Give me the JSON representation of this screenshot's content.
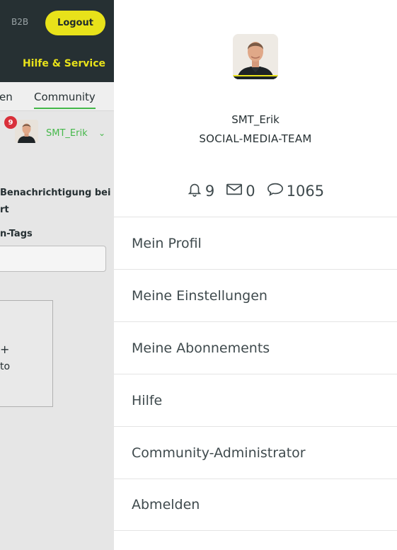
{
  "header": {
    "b2b_label": "B2B",
    "logout_label": "Logout",
    "hilfe_label": "Hilfe & Service"
  },
  "nav": {
    "prev_tab_partial": "en",
    "community_tab": "Community"
  },
  "user_bar": {
    "notification_count": "9",
    "username": "SMT_Erik"
  },
  "background_content": {
    "notification_text": "Benachrichtigung bei",
    "notification_text2": "rt",
    "tags_label": "n-Tags",
    "plus": "+",
    "upload_partial": "to"
  },
  "profile": {
    "username": "SMT_Erik",
    "role": "SOCIAL-MEDIA-TEAM",
    "stats": {
      "notifications": "9",
      "messages": "0",
      "comments": "1065"
    }
  },
  "menu": {
    "items": [
      {
        "label": "Mein Profil"
      },
      {
        "label": "Meine Einstellungen"
      },
      {
        "label": "Meine Abonnements"
      },
      {
        "label": "Hilfe"
      },
      {
        "label": "Community-Administrator"
      },
      {
        "label": "Abmelden"
      }
    ]
  },
  "colors": {
    "dark_header": "#263033",
    "accent_yellow": "#e8e21a",
    "accent_green": "#45b84a",
    "badge_red": "#d9303a"
  }
}
